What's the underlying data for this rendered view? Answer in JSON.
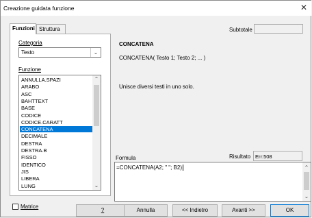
{
  "window": {
    "title": "Creazione guidata funzione",
    "close_glyph": "✕"
  },
  "tabs": [
    {
      "label": "Funzioni"
    },
    {
      "label": "Struttura"
    }
  ],
  "left": {
    "category_label": "Categoria",
    "category_value": "Testo",
    "function_label": "Funzione",
    "functions": [
      "ANNULLA.SPAZI",
      "ARABO",
      "ASC",
      "BAHTTEXT",
      "BASE",
      "CODICE",
      "CODICE.CARATT",
      "CONCATENA",
      "DECIMALE",
      "DESTRA",
      "DESTRA.B",
      "FISSO",
      "IDENTICO",
      "JIS",
      "LIBERA",
      "LUNG"
    ],
    "selected_function": "CONCATENA"
  },
  "right": {
    "function_name": "CONCATENA",
    "signature": "CONCATENA( Testo 1; Testo 2; ... )",
    "description": "Unisce diversi testi in uno solo.",
    "subtotal_label": "Subtotale",
    "subtotal_value": "",
    "formula_label": "Formula",
    "result_label": "Risultato",
    "result_value": "Err:508",
    "formula_value": "=CONCATENA(A2; \" \"; B2)"
  },
  "footer": {
    "matrix_label": "Matrice",
    "matrix_checked": false,
    "help_label": "?",
    "cancel_label": "Annulla",
    "back_label": "<< Indietro",
    "next_label": "Avanti >>",
    "ok_label": "OK"
  }
}
